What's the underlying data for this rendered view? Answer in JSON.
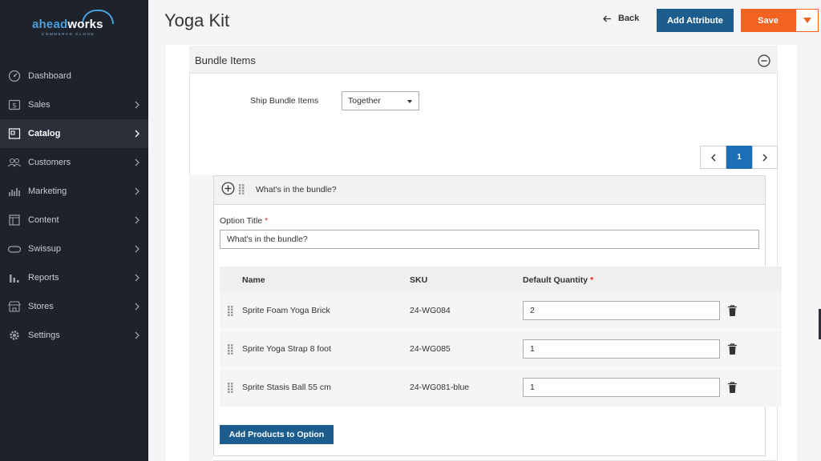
{
  "brand": {
    "logo_main_a": "ahead",
    "logo_main_b": "works",
    "logo_sub": "COMMERCE CLOUD"
  },
  "sidebar": {
    "items": [
      {
        "label": "Dashboard",
        "icon": "dashboard-icon"
      },
      {
        "label": "Sales",
        "icon": "dollar-icon"
      },
      {
        "label": "Catalog",
        "icon": "catalog-icon"
      },
      {
        "label": "Customers",
        "icon": "customers-icon"
      },
      {
        "label": "Marketing",
        "icon": "marketing-icon"
      },
      {
        "label": "Content",
        "icon": "content-icon"
      },
      {
        "label": "Swissup",
        "icon": "swissup-icon"
      },
      {
        "label": "Reports",
        "icon": "reports-icon"
      },
      {
        "label": "Stores",
        "icon": "stores-icon"
      },
      {
        "label": "Settings",
        "icon": "gear-icon"
      }
    ],
    "active": "Catalog"
  },
  "header": {
    "title": "Yoga Kit",
    "back_label": "Back",
    "add_attribute_label": "Add Attribute",
    "save_label": "Save"
  },
  "section": {
    "title": "Bundle Items",
    "ship_label": "Ship Bundle Items",
    "ship_value": "Together"
  },
  "pager": {
    "current": "1"
  },
  "option": {
    "header_title": "What's in the bundle?",
    "title_label": "Option Title",
    "required_mark": "*",
    "title_value": "What's in the bundle?",
    "columns": {
      "name": "Name",
      "sku": "SKU",
      "qty": "Default Quantity"
    },
    "rows": [
      {
        "name": "Sprite Foam Yoga Brick",
        "sku": "24-WG084",
        "qty": "2"
      },
      {
        "name": "Sprite Yoga Strap 8 foot",
        "sku": "24-WG085",
        "qty": "1"
      },
      {
        "name": "Sprite Stasis Ball 55 cm",
        "sku": "24-WG081-blue",
        "qty": "1"
      }
    ],
    "add_products_label": "Add Products to Option"
  },
  "colors": {
    "sidebar_bg": "#1e222b",
    "primary_blue": "#1c5d8e",
    "save_orange": "#f26322",
    "required_red": "#e22626",
    "pager_active": "#1a6fb8"
  }
}
